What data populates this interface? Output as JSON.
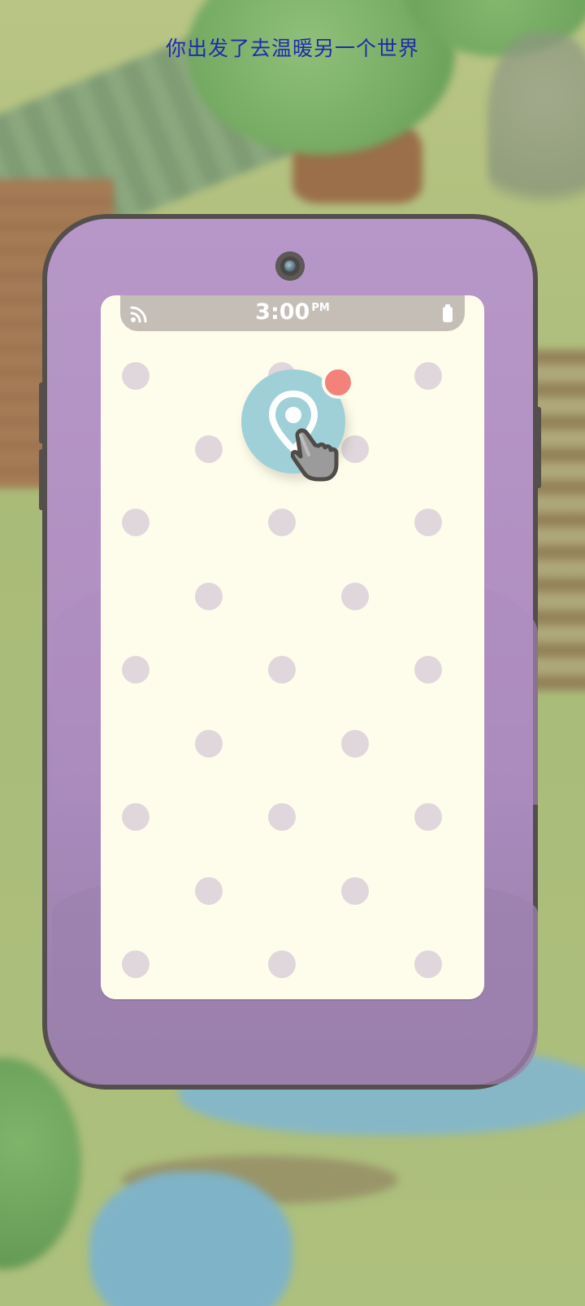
{
  "instruction": {
    "text": "你出发了去温暖另一个世界",
    "color": "#1f2ca8"
  },
  "phone": {
    "body_color": "#b797c8",
    "outline_color": "#544f4c",
    "screen_color": "#fefdec",
    "status_bar": {
      "time": "3:00",
      "ampm": "PM",
      "left_icon": "wifi-icon",
      "right_icon": "battery-icon"
    },
    "apps": [
      {
        "name": "map-app",
        "icon": "map-pin-icon",
        "color": "#9fd0d8",
        "notification_badge": true,
        "badge_color": "#f2827a"
      }
    ],
    "placeholder_dot_color": "#e0d7dc",
    "cursor_icon": "hand-pointer-icon"
  }
}
